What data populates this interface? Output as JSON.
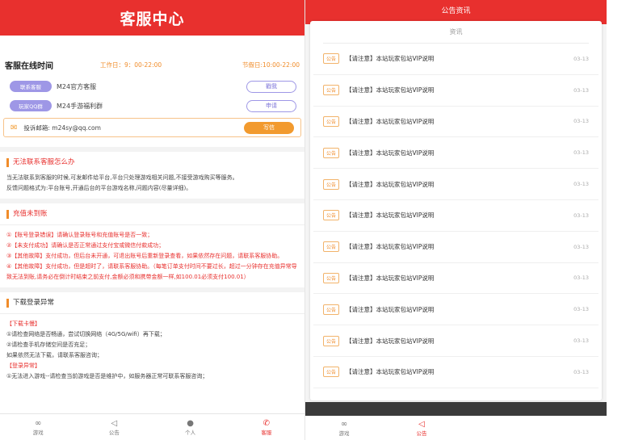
{
  "left": {
    "header_title": "客服中心",
    "online": {
      "title": "客服在线时间",
      "work_time": "工作日：9：00-22:00",
      "holiday_time": "节假日:10:00-22:00"
    },
    "contacts": [
      {
        "tag": "联系客服",
        "text": "M24官方客服",
        "button": "戳我"
      },
      {
        "tag": "玩家QQ群",
        "text": "M24手游福利群",
        "button": "申请"
      }
    ],
    "mail": {
      "text": "投诉邮箱: m24sy@qq.com",
      "button": "写信"
    },
    "sections": [
      {
        "title": "无法联系客服怎么办",
        "lines": [
          "当无法联系到客服的时候,可发邮件给平台,平台只处理游戏相关问题,不接受游戏购买等服务。",
          "反馈问题格式为:平台账号,开通后台的平台游戏名称,问题内容(尽量详细)。"
        ]
      },
      {
        "title": "充值未到账",
        "lines": [
          "①【账号登录错误】请确认登录账号和充值账号是否一致；",
          "②【未支付成功】请确认是否正常通过支付宝或微信付款成功；",
          "③【其他故障】支付成功，但后台未开通，可退出账号后重新登录查看，如果依然存在问题，请联系客服协助。",
          "④【其他故障】支付成功，但是超时了，请联系客服协助。（每笔订单支付时间不要过长，超过一分钟存在充值异常导致无法到账,请务必在倒计时结束之前支付,金额必须和携带金额一样,如100.01必须支付100.01）"
        ]
      },
      {
        "title": "下载登录异常",
        "lines": [
          "【下载卡慢】",
          "①请检查网络是否畅通，尝试切换网络（4G/5G/wifi）再下载；",
          "②请检查手机存储空间是否充足；",
          "如果依然无法下载，请联系客服咨询；",
          "【登录异常】",
          "①无法进入游戏--请检查当前游戏是否是维护中，如服务器正常可联系客服咨询；"
        ]
      }
    ],
    "tabs": [
      {
        "icon": "game-icon",
        "label": "游戏"
      },
      {
        "icon": "megaphone-icon",
        "label": "公告"
      },
      {
        "icon": "user-icon",
        "label": "个人"
      },
      {
        "icon": "phone-icon",
        "label": "客服"
      }
    ]
  },
  "right": {
    "header_title": "公告资讯",
    "card_title": "资讯",
    "news": [
      {
        "badge": "公告",
        "title": "【请注意】本站玩家包站VIP说明",
        "date": "03-13"
      },
      {
        "badge": "公告",
        "title": "【请注意】本站玩家包站VIP说明",
        "date": "03-13"
      },
      {
        "badge": "公告",
        "title": "【请注意】本站玩家包站VIP说明",
        "date": "03-13"
      },
      {
        "badge": "公告",
        "title": "【请注意】本站玩家包站VIP说明",
        "date": "03-13"
      },
      {
        "badge": "公告",
        "title": "【请注意】本站玩家包站VIP说明",
        "date": "03-13"
      },
      {
        "badge": "公告",
        "title": "【请注意】本站玩家包站VIP说明",
        "date": "03-13"
      },
      {
        "badge": "公告",
        "title": "【请注意】本站玩家包站VIP说明",
        "date": "03-13"
      },
      {
        "badge": "公告",
        "title": "【请注意】本站玩家包站VIP说明",
        "date": "03-13"
      },
      {
        "badge": "公告",
        "title": "【请注意】本站玩家包站VIP说明",
        "date": "03-13"
      },
      {
        "badge": "公告",
        "title": "【请注意】本站玩家包站VIP说明",
        "date": "03-13"
      },
      {
        "badge": "公告",
        "title": "【请注意】本站玩家包站VIP说明",
        "date": "03-13"
      }
    ],
    "tabs": [
      {
        "icon": "game-icon",
        "label": "游戏"
      },
      {
        "icon": "megaphone-icon",
        "label": "公告"
      }
    ]
  },
  "colors": {
    "brand_red": "#e8302e",
    "accent_orange": "#f29a2e",
    "pill_purple": "#9e97e6"
  }
}
